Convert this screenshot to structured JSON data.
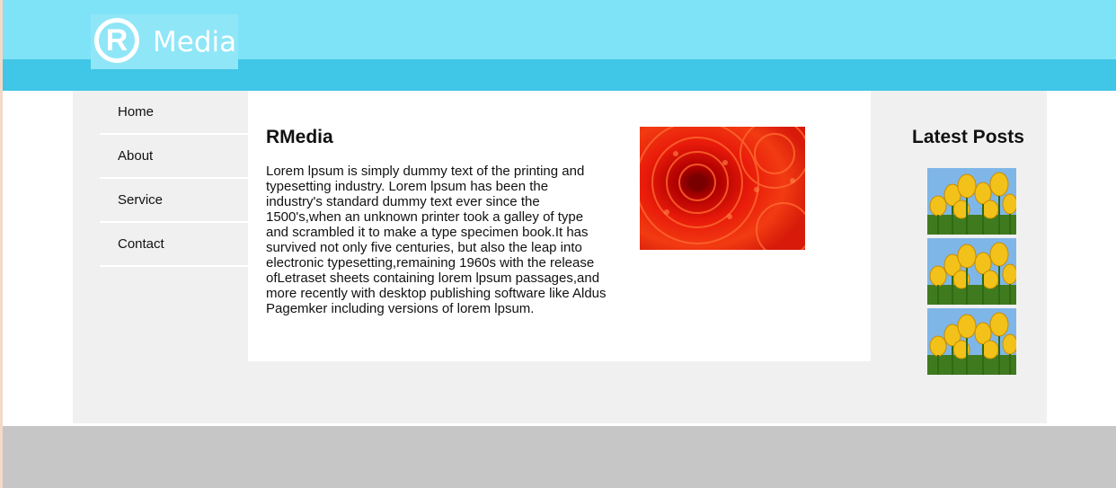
{
  "logo": {
    "mark": "R",
    "text": "Media"
  },
  "nav": {
    "items": [
      {
        "label": "Home"
      },
      {
        "label": "About"
      },
      {
        "label": "Service"
      },
      {
        "label": "Contact"
      }
    ]
  },
  "main": {
    "title": "RMedia",
    "body": "Lorem lpsum is simply dummy text of the printing and typesetting industry. Lorem lpsum has been the industry's standard dummy text ever since the 1500's,when an unknown printer took a galley of type and scrambled it to make a type specimen book.It has survived not only five centuries, but also the leap into electronic typesetting,remaining 1960s with the release ofLetraset sheets containing lorem lpsum passages,and more recently with desktop publishing software like Aldus Pagemker including versions of lorem lpsum.",
    "image_icon": "red-flower-photo"
  },
  "sidebar": {
    "title": "Latest Posts",
    "thumbnails": [
      {
        "icon": "tulips-photo"
      },
      {
        "icon": "tulips-photo"
      },
      {
        "icon": "tulips-photo"
      }
    ]
  },
  "colors": {
    "header_light": "#7ee3f7",
    "header_dark": "#40c6e6",
    "content_bg": "#f0f0f0",
    "footer": "#c6c6c6"
  }
}
